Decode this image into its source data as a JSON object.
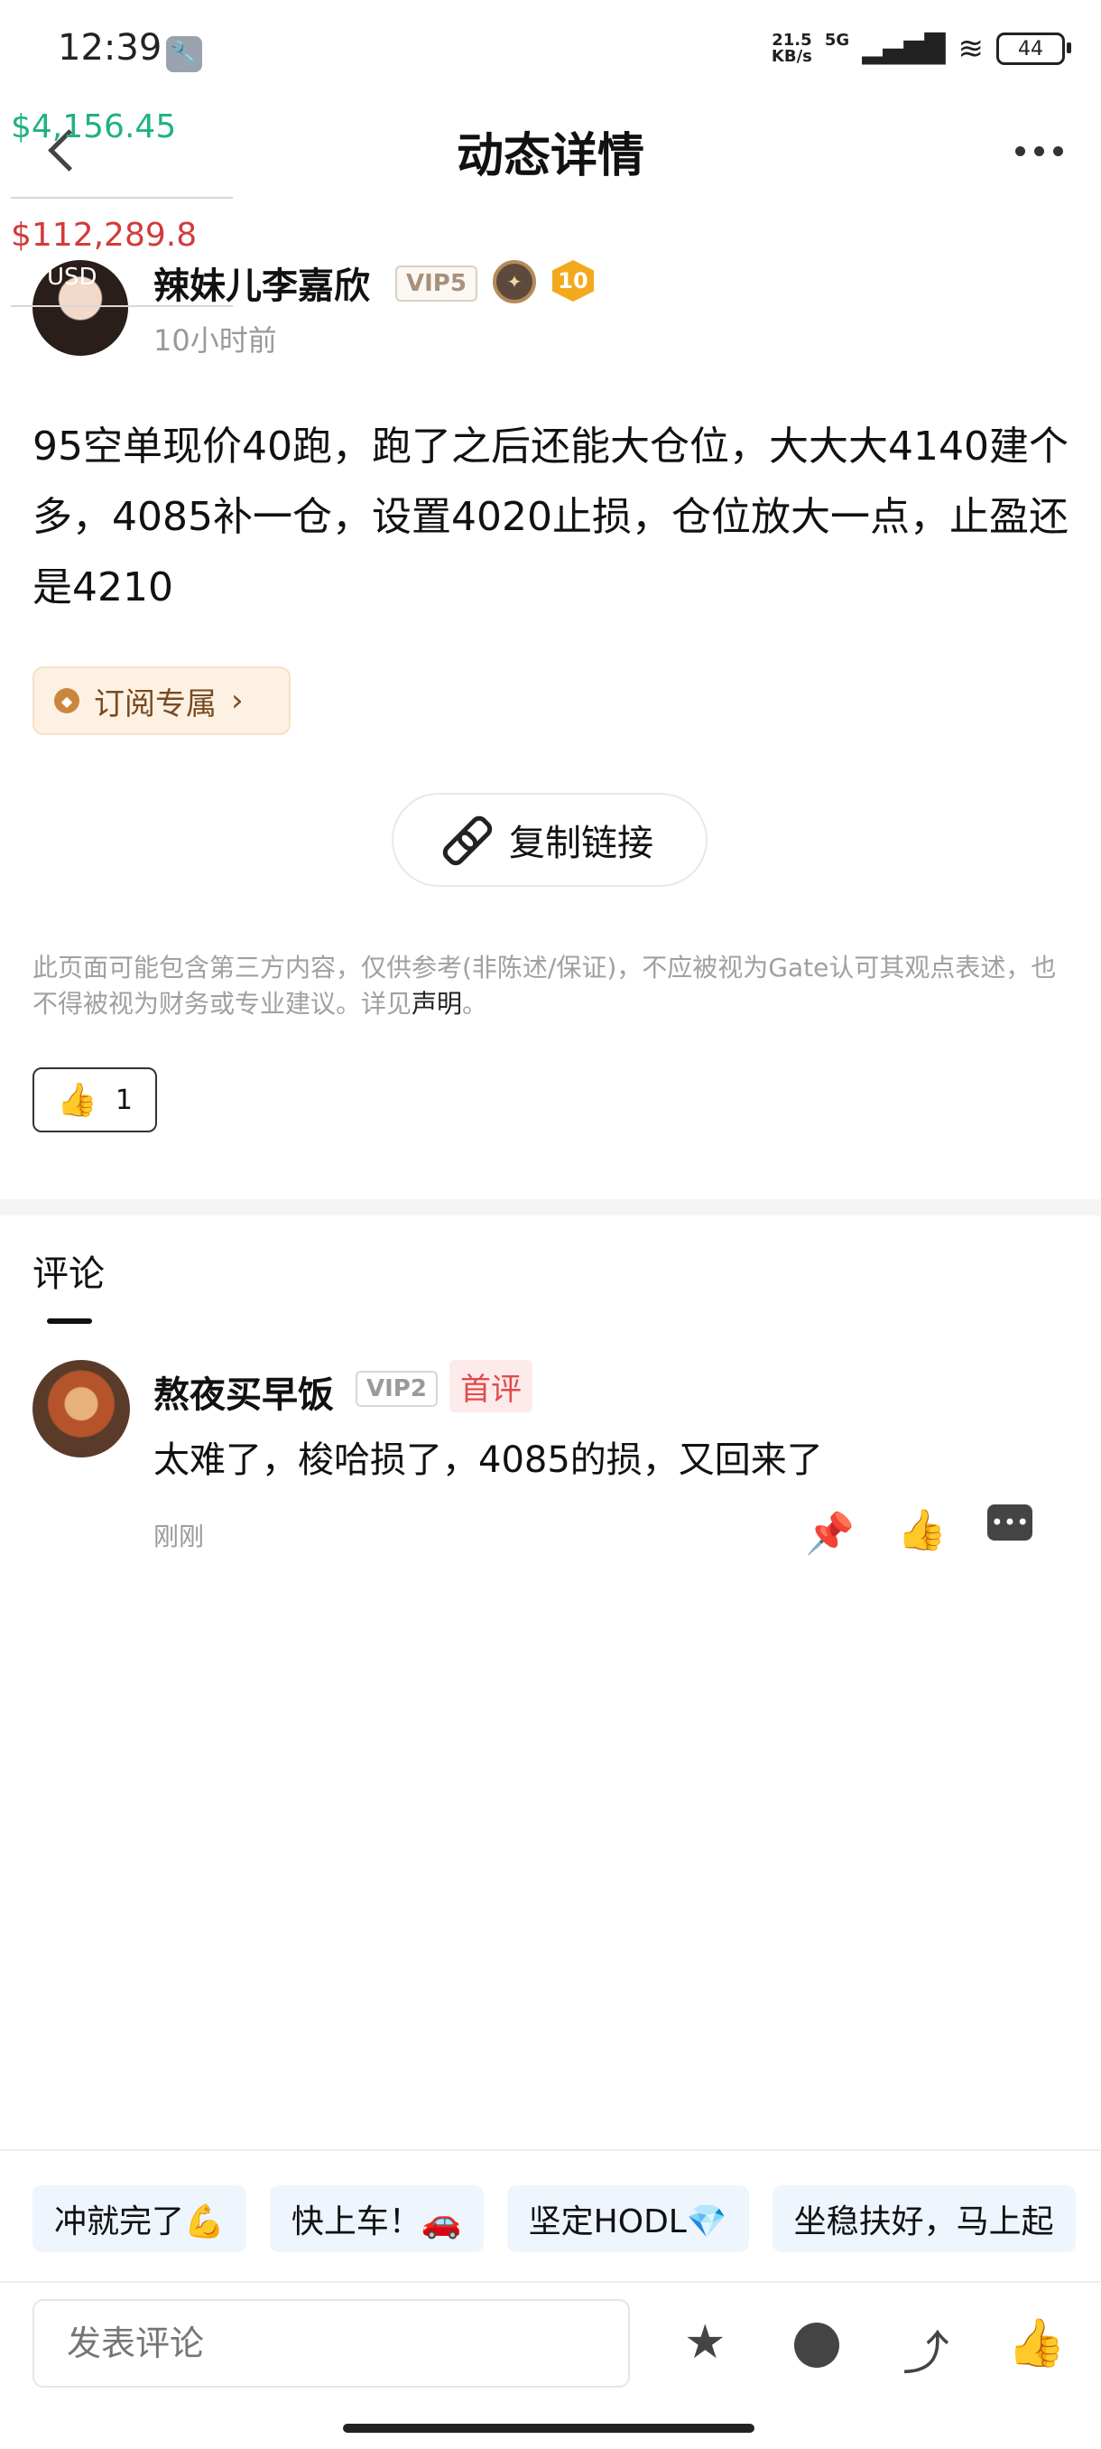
{
  "status_bar": {
    "time": "12:39",
    "net_speed_value": "21.5",
    "net_speed_unit": "KB/s",
    "network": "5G",
    "battery": "44"
  },
  "header": {
    "title": "动态详情"
  },
  "price_overlay": {
    "price_1": "$4,156.45",
    "price_2": "$112,289.8",
    "unit": "USD"
  },
  "author": {
    "name": "辣妹儿李嘉欣",
    "vip": "VIP5",
    "level": "10",
    "time": "10小时前"
  },
  "post": {
    "content": "95空单现价40跑，跑了之后还能大仓位，大大大4140建个多，4085补一仓，设置4020止损，仓位放大一点，止盈还是4210",
    "subscribe_label": "订阅专属",
    "copy_link": "复制链接",
    "disclaimer": "此页面可能包含第三方内容，仅供参考(非陈述/保证)，不应被视为Gate认可其观点表述，也不得被视为财务或专业建议。详见",
    "disclaimer_link": "声明",
    "disclaimer_end": "。",
    "like_count": "1"
  },
  "comments": {
    "title": "评论",
    "items": [
      {
        "name": "熬夜买早饭",
        "vip": "VIP2",
        "tag": "首评",
        "text": "太难了，梭哈损了，4085的损，又回来了",
        "time": "刚刚"
      }
    ]
  },
  "quick_replies": [
    "冲就完了💪",
    "快上车！🚗",
    "坚定HODL💎",
    "坐稳扶好，马上起"
  ],
  "bottom_bar": {
    "input_placeholder": "发表评论"
  },
  "colors": {
    "price_green": "#21b184",
    "price_red": "#d23a3a",
    "first_tag": "#e24a4a",
    "chip_bg": "#eef5fd"
  }
}
